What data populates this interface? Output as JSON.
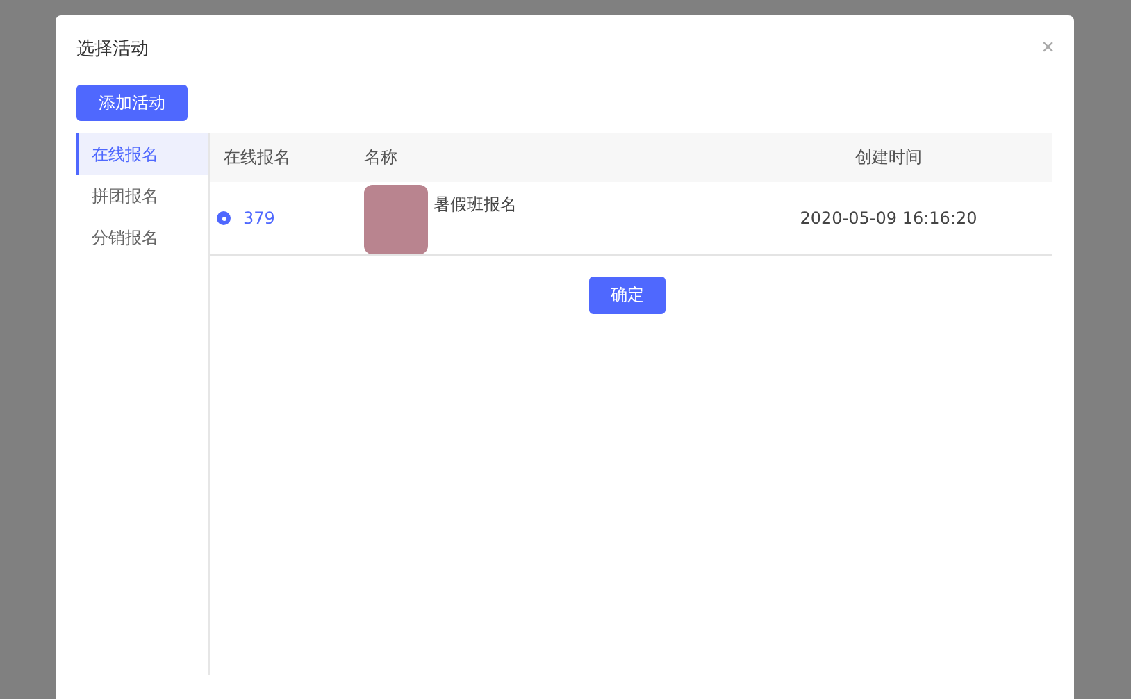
{
  "dialog": {
    "title": "选择活动",
    "close": "×",
    "add_button": "添加活动",
    "sidebar": {
      "items": [
        {
          "label": "在线报名",
          "selected": true
        },
        {
          "label": "拼团报名",
          "selected": false
        },
        {
          "label": "分销报名",
          "selected": false
        }
      ]
    },
    "table": {
      "columns": [
        "在线报名",
        "名称",
        "创建时间"
      ],
      "rows": [
        {
          "selected": true,
          "id": "379",
          "name": "暑假班报名",
          "created": "2020-05-09 16:16:20"
        }
      ]
    },
    "confirm_button": "确定"
  }
}
